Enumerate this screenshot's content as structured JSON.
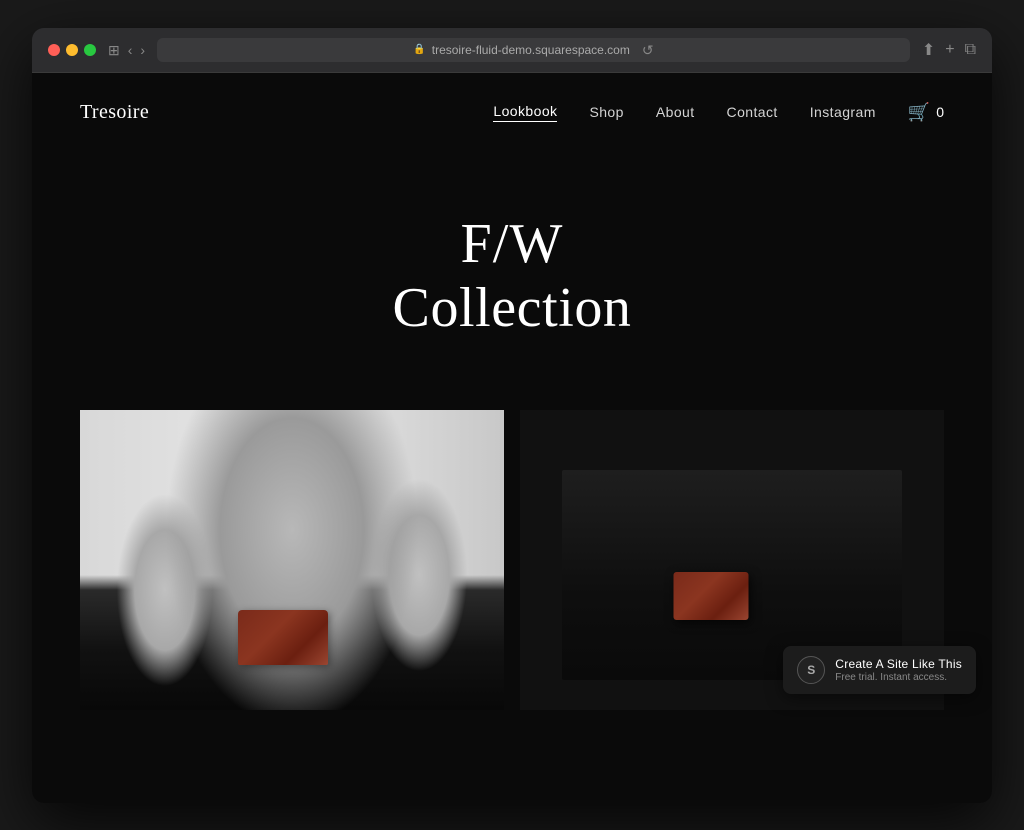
{
  "browser": {
    "url": "tresoire-fluid-demo.squarespace.com",
    "back_btn": "‹",
    "forward_btn": "›",
    "reload_btn": "↺",
    "window_btn": "⊞",
    "share_btn": "⬆",
    "new_tab_btn": "+",
    "tabs_btn": "⧉"
  },
  "nav": {
    "logo": "Tresoire",
    "links": [
      {
        "label": "Lookbook",
        "active": true
      },
      {
        "label": "Shop",
        "active": false
      },
      {
        "label": "About",
        "active": false
      },
      {
        "label": "Contact",
        "active": false
      },
      {
        "label": "Instagram",
        "active": false
      }
    ],
    "cart_count": "0"
  },
  "hero": {
    "line1": "F/W",
    "line2": "Collection"
  },
  "badge": {
    "title": "Create A Site Like This",
    "subtitle": "Free trial. Instant access.",
    "logo_text": "S"
  }
}
